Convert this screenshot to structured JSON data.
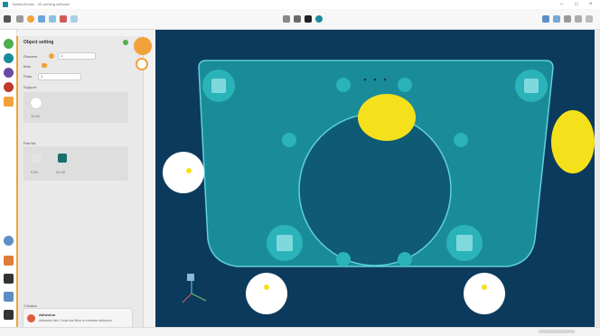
{
  "window": {
    "title": "BambuStudio - 3D printing software"
  },
  "panel": {
    "header": "Object setting",
    "filament_label": "Filament",
    "filament_value": "1",
    "brim_label": "Brim",
    "support_label": "Support",
    "plate_label": "Plate",
    "plate_value": "1",
    "object_label": "Object",
    "object_value": "11.00",
    "parts_label": "Part list",
    "part1_value": "0.00",
    "part2_value": "31.00",
    "notif_count": "1 Notice",
    "notif_title": "Adhesion",
    "notif_body": "Adhesion hint: Could use Brim to enhance adhesion."
  },
  "colors": {
    "accent": "#f2a23a",
    "canvas_bg": "#0c3a5c",
    "plate": "#1a8c99",
    "yellow": "#f4e11c"
  },
  "icons": [
    "menu-icon",
    "save-icon",
    "undo-icon",
    "redo-icon",
    "slice-icon",
    "print-icon",
    "move-icon",
    "rotate-icon",
    "scale-icon",
    "cut-icon",
    "settings-icon",
    "close-icon"
  ]
}
